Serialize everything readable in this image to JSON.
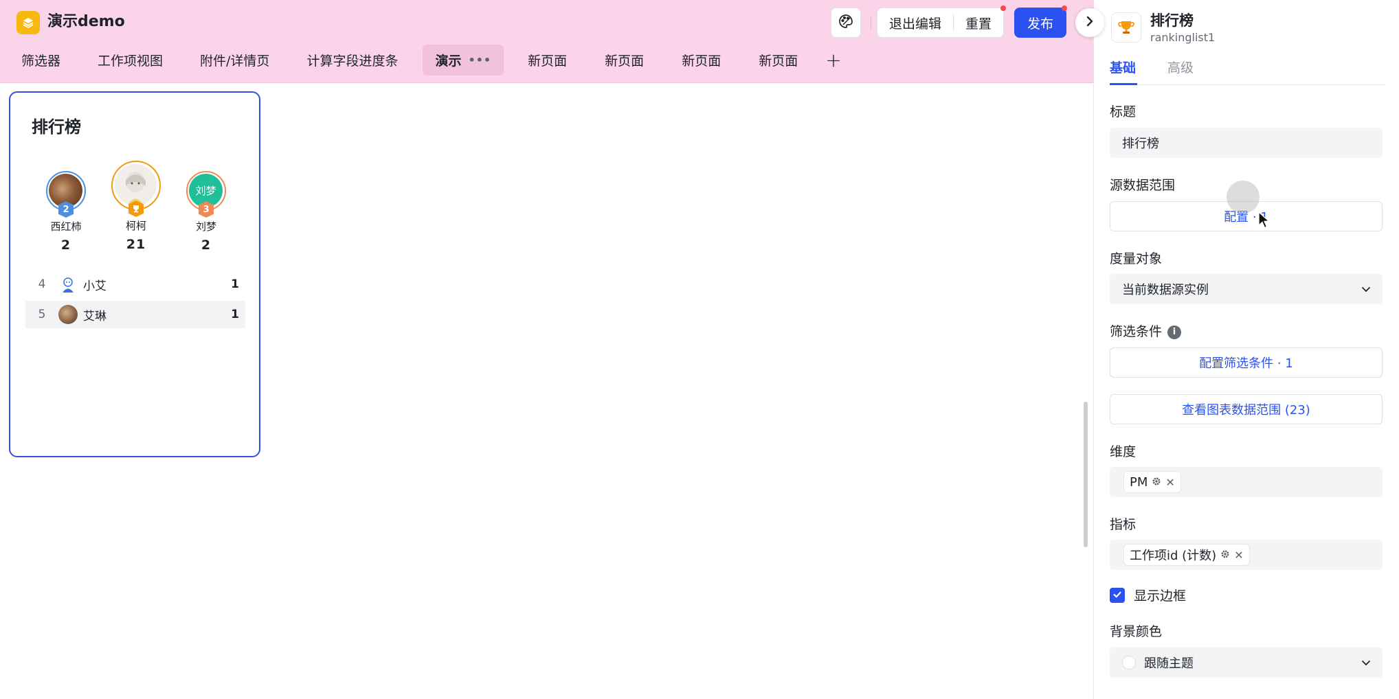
{
  "app": {
    "title": "演示demo"
  },
  "header": {
    "exit_edit_label": "退出编辑",
    "reset_label": "重置",
    "publish_label": "发布"
  },
  "tabs": [
    {
      "label": "筛选器"
    },
    {
      "label": "工作项视图"
    },
    {
      "label": "附件/详情页"
    },
    {
      "label": "计算字段进度条"
    },
    {
      "label": "演示",
      "active": true
    },
    {
      "label": "新页面"
    },
    {
      "label": "新页面"
    },
    {
      "label": "新页面"
    },
    {
      "label": "新页面"
    }
  ],
  "ranking_card": {
    "title": "排行榜",
    "podium": [
      {
        "rank": "2",
        "name": "西红柿",
        "value": "2"
      },
      {
        "rank": "1",
        "name": "柯柯",
        "value": "21"
      },
      {
        "rank": "3",
        "name": "刘梦",
        "avatar_text": "刘梦",
        "value": "2"
      }
    ],
    "rows": [
      {
        "rank": "4",
        "name": "小艾",
        "value": "1"
      },
      {
        "rank": "5",
        "name": "艾琳",
        "value": "1"
      }
    ]
  },
  "panel": {
    "component_name": "排行榜",
    "component_id": "rankinglist1",
    "tabs": {
      "basic": "基础",
      "advanced": "高级"
    },
    "title_label": "标题",
    "title_value": "排行榜",
    "source_label": "源数据范围",
    "source_button": "配置 · 1",
    "measure_label": "度量对象",
    "measure_value": "当前数据源实例",
    "filter_label": "筛选条件",
    "filter_button": "配置筛选条件 · 1",
    "view_range_button": "查看图表数据范围 (23)",
    "dimension_label": "维度",
    "dimension_chip": "PM",
    "metric_label": "指标",
    "metric_chip": "工作项id (计数)",
    "show_border_label": "显示边框",
    "show_border_checked": true,
    "bg_color_label": "背景颜色",
    "bg_color_value": "跟随主题"
  },
  "colors": {
    "header_bg": "#fbd4ea",
    "primary": "#2b52f0",
    "card_border": "#3050e0",
    "gold": "#f59a0c",
    "silver_blue": "#4a8fe0",
    "bronze": "#f08a55",
    "liumeng_avatar": "#1fbf9a"
  },
  "icons": {
    "app_logo": "layers-icon",
    "theme": "palette-icon",
    "collapse": "chevron-right-icon",
    "component": "trophy-icon",
    "dropdown": "chevron-down-icon",
    "info": "info-icon",
    "gear": "gear-icon",
    "close": "close-icon",
    "check": "check-icon"
  }
}
